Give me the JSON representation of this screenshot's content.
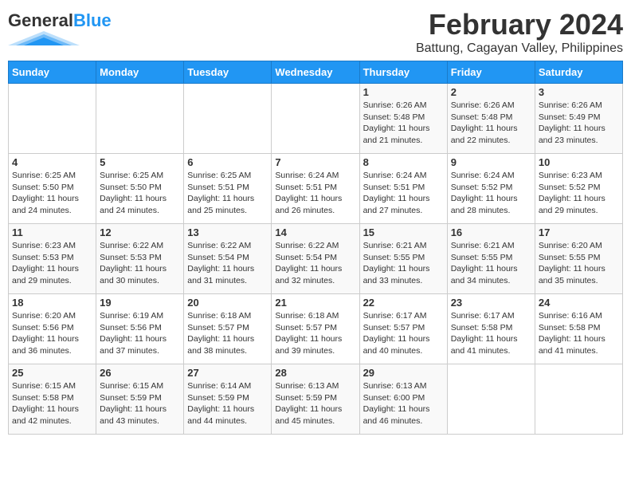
{
  "header": {
    "logo_general": "General",
    "logo_blue": "Blue",
    "title": "February 2024",
    "subtitle": "Battung, Cagayan Valley, Philippines"
  },
  "weekdays": [
    "Sunday",
    "Monday",
    "Tuesday",
    "Wednesday",
    "Thursday",
    "Friday",
    "Saturday"
  ],
  "weeks": [
    [
      {
        "day": "",
        "info": ""
      },
      {
        "day": "",
        "info": ""
      },
      {
        "day": "",
        "info": ""
      },
      {
        "day": "",
        "info": ""
      },
      {
        "day": "1",
        "info": "Sunrise: 6:26 AM\nSunset: 5:48 PM\nDaylight: 11 hours and 21 minutes."
      },
      {
        "day": "2",
        "info": "Sunrise: 6:26 AM\nSunset: 5:48 PM\nDaylight: 11 hours and 22 minutes."
      },
      {
        "day": "3",
        "info": "Sunrise: 6:26 AM\nSunset: 5:49 PM\nDaylight: 11 hours and 23 minutes."
      }
    ],
    [
      {
        "day": "4",
        "info": "Sunrise: 6:25 AM\nSunset: 5:50 PM\nDaylight: 11 hours and 24 minutes."
      },
      {
        "day": "5",
        "info": "Sunrise: 6:25 AM\nSunset: 5:50 PM\nDaylight: 11 hours and 24 minutes."
      },
      {
        "day": "6",
        "info": "Sunrise: 6:25 AM\nSunset: 5:51 PM\nDaylight: 11 hours and 25 minutes."
      },
      {
        "day": "7",
        "info": "Sunrise: 6:24 AM\nSunset: 5:51 PM\nDaylight: 11 hours and 26 minutes."
      },
      {
        "day": "8",
        "info": "Sunrise: 6:24 AM\nSunset: 5:51 PM\nDaylight: 11 hours and 27 minutes."
      },
      {
        "day": "9",
        "info": "Sunrise: 6:24 AM\nSunset: 5:52 PM\nDaylight: 11 hours and 28 minutes."
      },
      {
        "day": "10",
        "info": "Sunrise: 6:23 AM\nSunset: 5:52 PM\nDaylight: 11 hours and 29 minutes."
      }
    ],
    [
      {
        "day": "11",
        "info": "Sunrise: 6:23 AM\nSunset: 5:53 PM\nDaylight: 11 hours and 29 minutes."
      },
      {
        "day": "12",
        "info": "Sunrise: 6:22 AM\nSunset: 5:53 PM\nDaylight: 11 hours and 30 minutes."
      },
      {
        "day": "13",
        "info": "Sunrise: 6:22 AM\nSunset: 5:54 PM\nDaylight: 11 hours and 31 minutes."
      },
      {
        "day": "14",
        "info": "Sunrise: 6:22 AM\nSunset: 5:54 PM\nDaylight: 11 hours and 32 minutes."
      },
      {
        "day": "15",
        "info": "Sunrise: 6:21 AM\nSunset: 5:55 PM\nDaylight: 11 hours and 33 minutes."
      },
      {
        "day": "16",
        "info": "Sunrise: 6:21 AM\nSunset: 5:55 PM\nDaylight: 11 hours and 34 minutes."
      },
      {
        "day": "17",
        "info": "Sunrise: 6:20 AM\nSunset: 5:55 PM\nDaylight: 11 hours and 35 minutes."
      }
    ],
    [
      {
        "day": "18",
        "info": "Sunrise: 6:20 AM\nSunset: 5:56 PM\nDaylight: 11 hours and 36 minutes."
      },
      {
        "day": "19",
        "info": "Sunrise: 6:19 AM\nSunset: 5:56 PM\nDaylight: 11 hours and 37 minutes."
      },
      {
        "day": "20",
        "info": "Sunrise: 6:18 AM\nSunset: 5:57 PM\nDaylight: 11 hours and 38 minutes."
      },
      {
        "day": "21",
        "info": "Sunrise: 6:18 AM\nSunset: 5:57 PM\nDaylight: 11 hours and 39 minutes."
      },
      {
        "day": "22",
        "info": "Sunrise: 6:17 AM\nSunset: 5:57 PM\nDaylight: 11 hours and 40 minutes."
      },
      {
        "day": "23",
        "info": "Sunrise: 6:17 AM\nSunset: 5:58 PM\nDaylight: 11 hours and 41 minutes."
      },
      {
        "day": "24",
        "info": "Sunrise: 6:16 AM\nSunset: 5:58 PM\nDaylight: 11 hours and 41 minutes."
      }
    ],
    [
      {
        "day": "25",
        "info": "Sunrise: 6:15 AM\nSunset: 5:58 PM\nDaylight: 11 hours and 42 minutes."
      },
      {
        "day": "26",
        "info": "Sunrise: 6:15 AM\nSunset: 5:59 PM\nDaylight: 11 hours and 43 minutes."
      },
      {
        "day": "27",
        "info": "Sunrise: 6:14 AM\nSunset: 5:59 PM\nDaylight: 11 hours and 44 minutes."
      },
      {
        "day": "28",
        "info": "Sunrise: 6:13 AM\nSunset: 5:59 PM\nDaylight: 11 hours and 45 minutes."
      },
      {
        "day": "29",
        "info": "Sunrise: 6:13 AM\nSunset: 6:00 PM\nDaylight: 11 hours and 46 minutes."
      },
      {
        "day": "",
        "info": ""
      },
      {
        "day": "",
        "info": ""
      }
    ]
  ]
}
